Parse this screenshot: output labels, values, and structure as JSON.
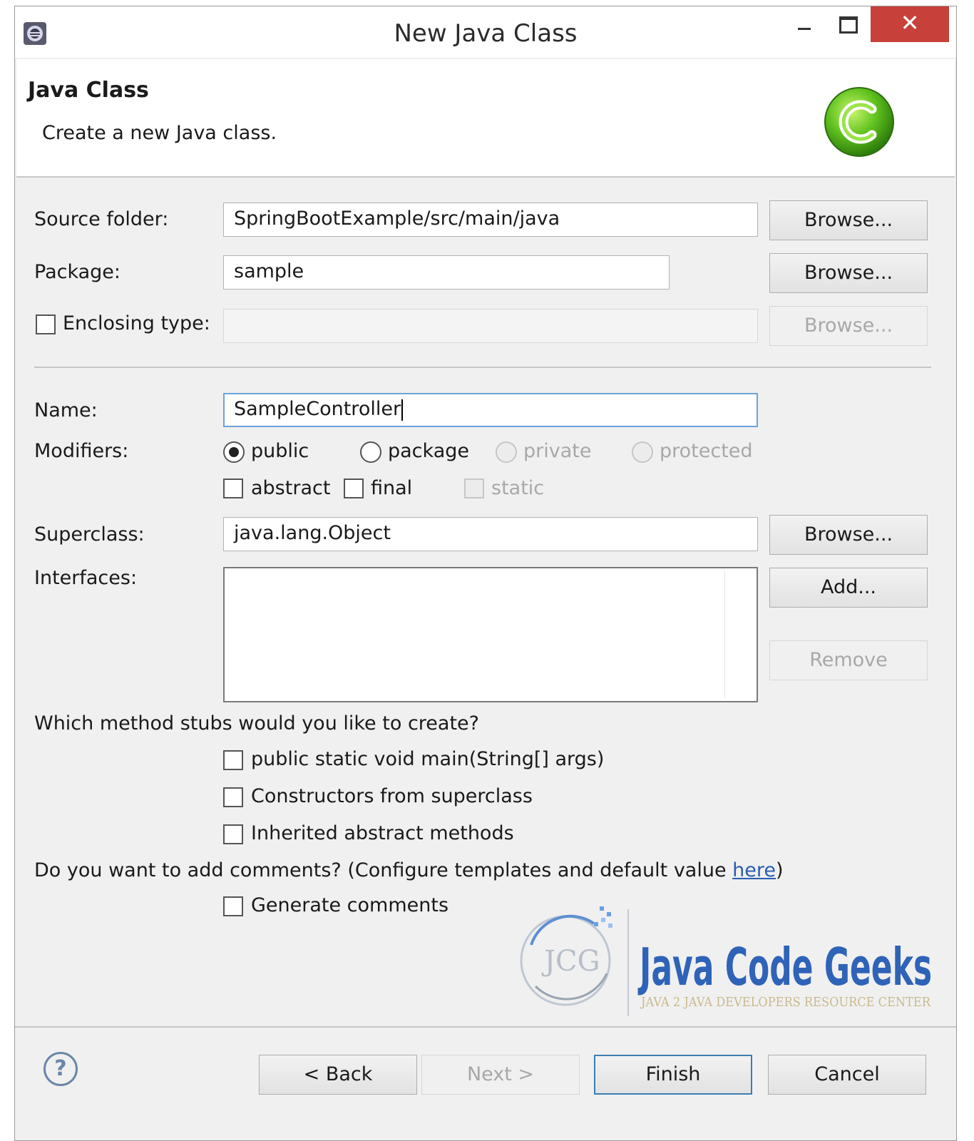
{
  "window": {
    "title": "New Java Class"
  },
  "header": {
    "title": "Java Class",
    "description": "Create a new Java class."
  },
  "form": {
    "source_folder_label": "Source folder:",
    "source_folder_value": "SpringBootExample/src/main/java",
    "package_label": "Package:",
    "package_value": "sample",
    "enclosing_type_label": "Enclosing type:",
    "enclosing_type_value": "",
    "name_label": "Name:",
    "name_value": "SampleController",
    "modifiers_label": "Modifiers:",
    "modifiers": [
      {
        "label": "public",
        "checked": true,
        "enabled": true
      },
      {
        "label": "package",
        "checked": false,
        "enabled": true
      },
      {
        "label": "private",
        "checked": false,
        "enabled": false
      },
      {
        "label": "protected",
        "checked": false,
        "enabled": false
      }
    ],
    "modifier_checks": [
      {
        "label": "abstract",
        "checked": false,
        "enabled": true
      },
      {
        "label": "final",
        "checked": false,
        "enabled": true
      },
      {
        "label": "static",
        "checked": false,
        "enabled": false
      }
    ],
    "superclass_label": "Superclass:",
    "superclass_value": "java.lang.Object",
    "interfaces_label": "Interfaces:",
    "browse_label": "Browse...",
    "add_label": "Add...",
    "remove_label": "Remove"
  },
  "stubs": {
    "question": "Which method stubs would you like to create?",
    "options": [
      {
        "label": "public static void main(String[] args)",
        "checked": false
      },
      {
        "label": "Constructors from superclass",
        "checked": false
      },
      {
        "label": "Inherited abstract methods",
        "checked": false
      }
    ]
  },
  "comments": {
    "question_prefix": "Do you want to add comments? (Configure templates and default value ",
    "link_text": "here",
    "question_suffix": ")",
    "generate_label": "Generate comments",
    "generate_checked": false
  },
  "watermark": {
    "logo_text": "JCG",
    "brand": "Java Code Geeks",
    "tagline": "JAVA 2 JAVA DEVELOPERS RESOURCE CENTER"
  },
  "footer": {
    "back_label": "< Back",
    "next_label": "Next >",
    "finish_label": "Finish",
    "cancel_label": "Cancel"
  },
  "colors": {
    "accent": "#3c7fb1",
    "close_button": "#c7403a",
    "link": "#2a5db0",
    "brand_blue": "#2f63b8",
    "brand_green": "#6aa82b"
  }
}
